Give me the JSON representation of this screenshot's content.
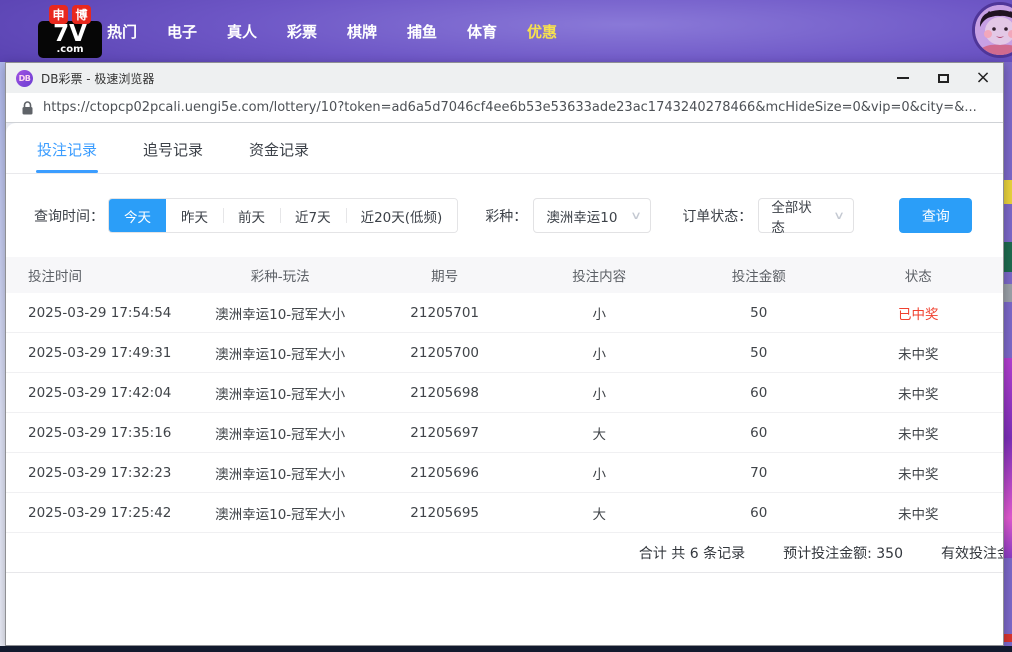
{
  "site_nav": {
    "logo": {
      "badge1": "申",
      "badge2": "博",
      "main": "7V",
      "suffix": ".com"
    },
    "items": [
      {
        "label": "热门"
      },
      {
        "label": "电子"
      },
      {
        "label": "真人"
      },
      {
        "label": "彩票"
      },
      {
        "label": "棋牌"
      },
      {
        "label": "捕鱼"
      },
      {
        "label": "体育"
      },
      {
        "label": "优惠",
        "highlight": true
      }
    ]
  },
  "browser": {
    "title": "DB彩票 - 极速浏览器",
    "favicon_text": "DB",
    "close_glyph": "×",
    "url": "https://ctopcp02pcali.uengi5e.com/lottery/10?token=ad6a5d7046cf4ee6b53e53633ade23ac1743240278466&mcHideSize=0&vip=0&city=&..."
  },
  "tabs": [
    {
      "label": "投注记录",
      "active": true
    },
    {
      "label": "追号记录",
      "active": false
    },
    {
      "label": "资金记录",
      "active": false
    }
  ],
  "filters": {
    "time_label": "查询时间：",
    "time_options": [
      {
        "label": "今天",
        "active": true
      },
      {
        "label": "昨天",
        "active": false
      },
      {
        "label": "前天",
        "active": false
      },
      {
        "label": "近7天",
        "active": false
      },
      {
        "label": "近20天(低频)",
        "active": false
      }
    ],
    "lottery_label": "彩种：",
    "lottery_value": "澳洲幸运10",
    "status_label": "订单状态：",
    "status_value": "全部状态",
    "chevron_glyph": "∨",
    "search_button": "查询"
  },
  "table": {
    "columns": [
      "投注时间",
      "彩种-玩法",
      "期号",
      "投注内容",
      "投注金额",
      "状态"
    ],
    "rows": [
      {
        "time": "2025-03-29 17:54:54",
        "play": "澳洲幸运10-冠军大小",
        "issue": "21205701",
        "content": "小",
        "amount": "50",
        "status": "已中奖",
        "won": true
      },
      {
        "time": "2025-03-29 17:49:31",
        "play": "澳洲幸运10-冠军大小",
        "issue": "21205700",
        "content": "小",
        "amount": "50",
        "status": "未中奖",
        "won": false
      },
      {
        "time": "2025-03-29 17:42:04",
        "play": "澳洲幸运10-冠军大小",
        "issue": "21205698",
        "content": "小",
        "amount": "60",
        "status": "未中奖",
        "won": false
      },
      {
        "time": "2025-03-29 17:35:16",
        "play": "澳洲幸运10-冠军大小",
        "issue": "21205697",
        "content": "大",
        "amount": "60",
        "status": "未中奖",
        "won": false
      },
      {
        "time": "2025-03-29 17:32:23",
        "play": "澳洲幸运10-冠军大小",
        "issue": "21205696",
        "content": "小",
        "amount": "70",
        "status": "未中奖",
        "won": false
      },
      {
        "time": "2025-03-29 17:25:42",
        "play": "澳洲幸运10-冠军大小",
        "issue": "21205695",
        "content": "大",
        "amount": "60",
        "status": "未中奖",
        "won": false
      }
    ]
  },
  "summary": {
    "total": "合计 共 6 条记录",
    "expected": "预计投注金额: 350",
    "valid_partial": "有效投注金"
  },
  "colors": {
    "accent_blue": "#2b9ef8",
    "tab_blue": "#3b9dff",
    "win_red": "#f0412f",
    "topbar_purple": "#6e57c6",
    "highlight_yellow": "#f7e14e"
  }
}
